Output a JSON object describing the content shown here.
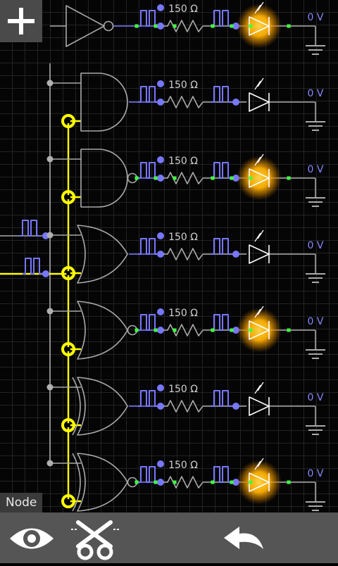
{
  "toolbar": {
    "add_icon": "plus-icon",
    "view_icon": "eye-icon",
    "cut_icon": "scissors-icon",
    "undo_icon": "undo-arrow-icon",
    "node_label": "Node"
  },
  "colors": {
    "wire": "#aaaaaa",
    "active_wire": "#ffff00",
    "signal": "#7777ff",
    "led_on_glow": "#ffc800",
    "toolbar_bg": "#555555"
  },
  "circuit": {
    "rows": [
      {
        "gate": "not-gate",
        "resistor": "150 Ω",
        "voltage": "0 V",
        "led_on": true
      },
      {
        "gate": "and-gate",
        "resistor": "150 Ω",
        "voltage": "0 V",
        "led_on": false
      },
      {
        "gate": "nand-gate",
        "resistor": "150 Ω",
        "voltage": "0 V",
        "led_on": true
      },
      {
        "gate": "or-gate",
        "resistor": "150 Ω",
        "voltage": "0 V",
        "led_on": false
      },
      {
        "gate": "nor-gate",
        "resistor": "150 Ω",
        "voltage": "0 V",
        "led_on": true
      },
      {
        "gate": "xor-gate",
        "resistor": "150 Ω",
        "voltage": "0 V",
        "led_on": false
      },
      {
        "gate": "xnor-gate",
        "resistor": "150 Ω",
        "voltage": "0 V",
        "led_on": true
      }
    ]
  }
}
